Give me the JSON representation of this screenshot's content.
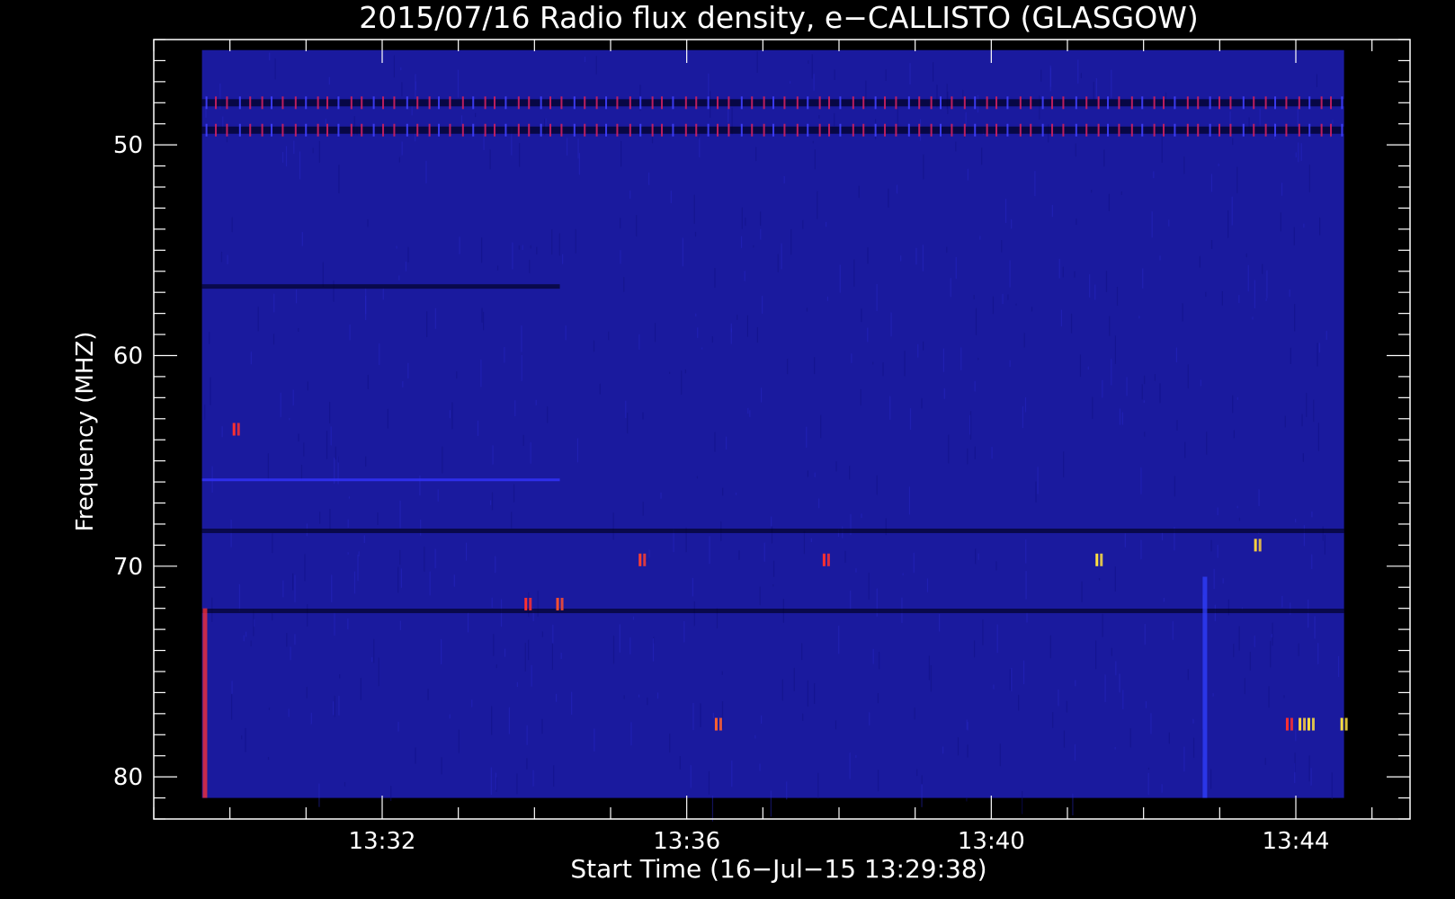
{
  "chart_data": {
    "type": "heatmap",
    "title": "2015/07/16  Radio flux density, e−CALLISTO (GLASGOW)",
    "xlabel": "Start Time (16−Jul−15 13:29:38)",
    "ylabel": "Frequency (MHZ)",
    "x_range_minutes": [
      "13:29:00",
      "13:45:30"
    ],
    "y_range_mhz": [
      45.0,
      82.0
    ],
    "y_reversed": true,
    "x_ticks": [
      "13:32",
      "13:36",
      "13:40",
      "13:44"
    ],
    "y_ticks": [
      50,
      60,
      70,
      80
    ],
    "data_extent": {
      "start": "13:29:38",
      "end": "13:44:38",
      "freq_min_mhz": 45.5,
      "freq_max_mhz": 81.0
    },
    "colors": {
      "background_level": "#1a1a9e",
      "low": "#000020",
      "mid": "#3333ff",
      "high": "#ff2020",
      "peak": "#ffff40"
    },
    "features": {
      "rfi_bands": [
        {
          "freq_mhz": 48.0,
          "type": "periodic",
          "color": "#d02060"
        },
        {
          "freq_mhz": 49.3,
          "type": "periodic",
          "color": "#d02060"
        }
      ],
      "dark_lines": [
        {
          "freq_mhz": 56.7,
          "start": "13:29:38",
          "end": "13:34:20"
        },
        {
          "freq_mhz": 72.1,
          "start": "13:29:38",
          "end": "13:44:38"
        },
        {
          "freq_mhz": 68.3,
          "start": "13:29:38",
          "end": "13:44:38"
        }
      ],
      "bright_lines": [
        {
          "freq_mhz": 65.9,
          "start": "13:29:38",
          "end": "13:34:20"
        }
      ],
      "vertical_streaks": [
        {
          "time": "13:29:40",
          "freq_from_mhz": 72.0,
          "freq_to_mhz": 81.0,
          "color": "#ff3030"
        },
        {
          "time": "13:42:48",
          "freq_from_mhz": 70.5,
          "freq_to_mhz": 81.0,
          "color": "#3040ff"
        }
      ],
      "bursts": [
        {
          "time": "13:33:55",
          "freq_mhz": 71.8,
          "color": "#ff3030"
        },
        {
          "time": "13:34:20",
          "freq_mhz": 71.8,
          "color": "#ff5030"
        },
        {
          "time": "13:35:25",
          "freq_mhz": 69.7,
          "color": "#ff4030"
        },
        {
          "time": "13:36:25",
          "freq_mhz": 77.5,
          "color": "#ff6030"
        },
        {
          "time": "13:37:50",
          "freq_mhz": 69.7,
          "color": "#ff3030"
        },
        {
          "time": "13:41:25",
          "freq_mhz": 69.7,
          "color": "#ffe040"
        },
        {
          "time": "13:43:30",
          "freq_mhz": 69.0,
          "color": "#ffd040"
        },
        {
          "time": "13:43:55",
          "freq_mhz": 77.5,
          "color": "#ff3030"
        },
        {
          "time": "13:44:05",
          "freq_mhz": 77.5,
          "color": "#ffd040"
        },
        {
          "time": "13:44:12",
          "freq_mhz": 77.5,
          "color": "#ffe040"
        },
        {
          "time": "13:44:38",
          "freq_mhz": 77.5,
          "color": "#ffe040"
        },
        {
          "time": "13:30:05",
          "freq_mhz": 63.5,
          "color": "#ff3030"
        }
      ]
    }
  }
}
